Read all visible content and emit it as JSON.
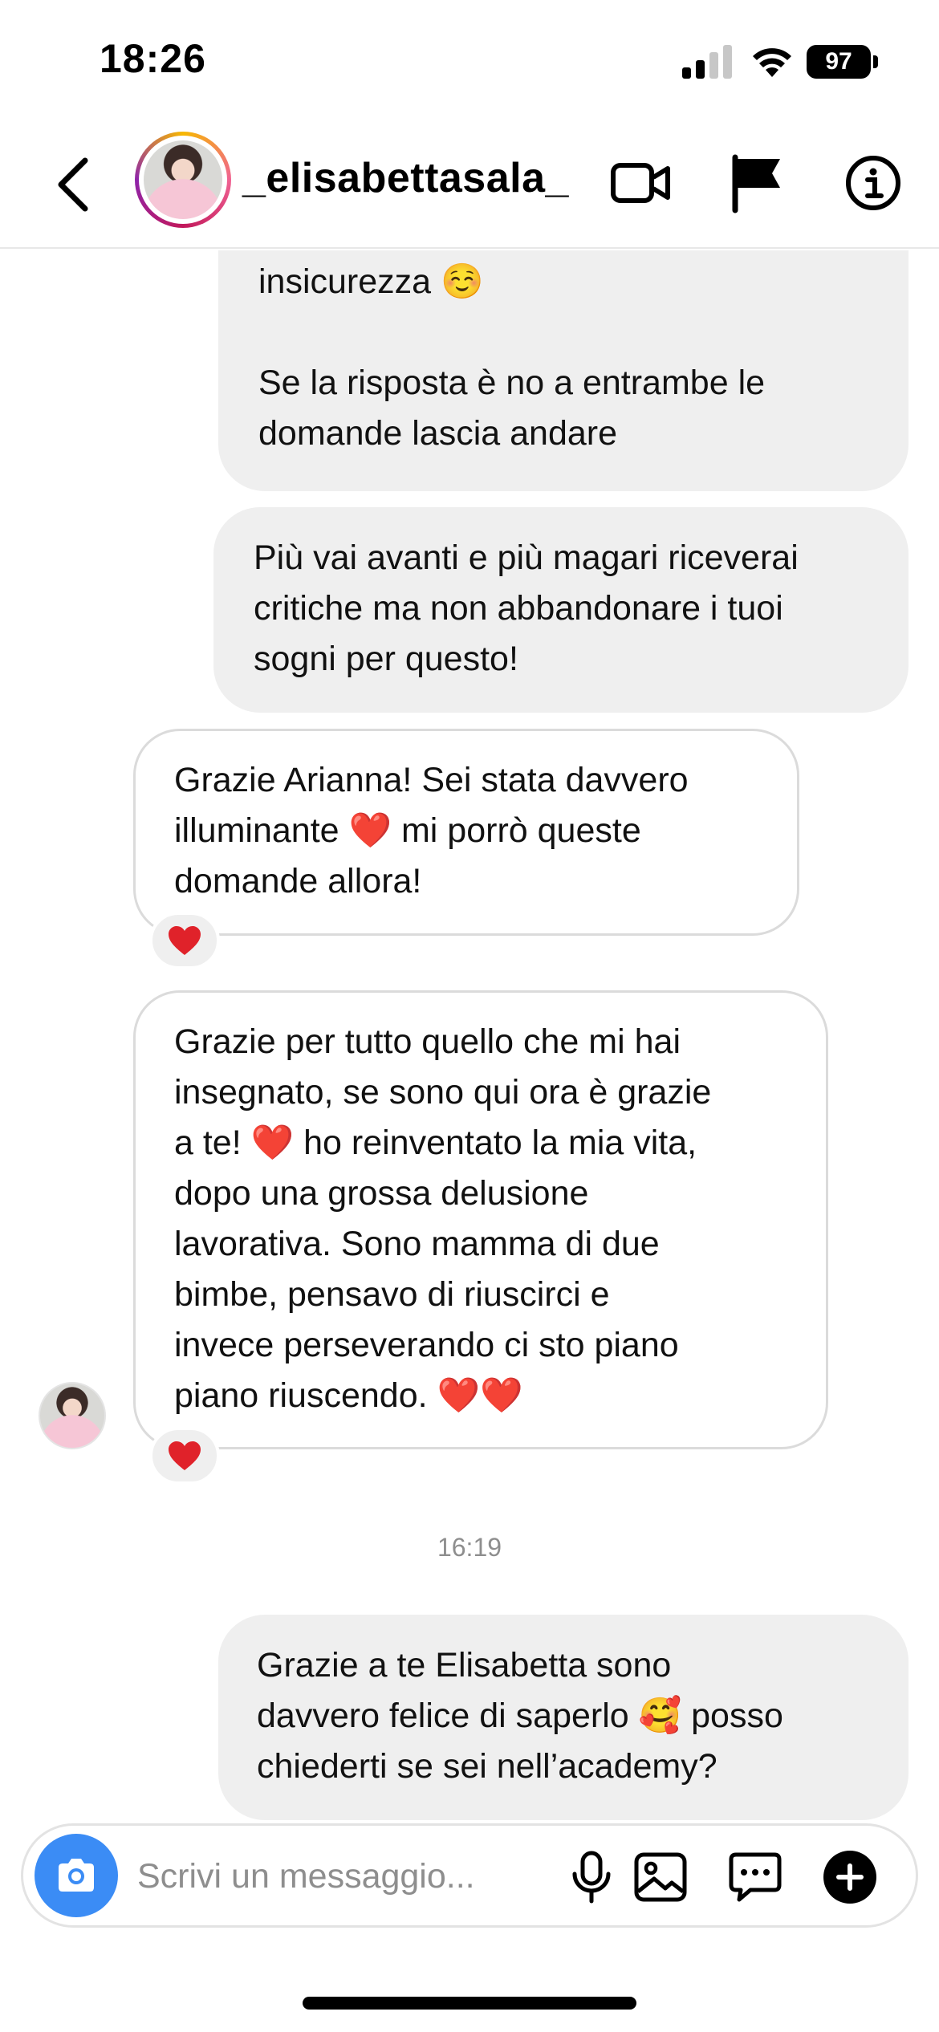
{
  "status_bar": {
    "time": "18:26",
    "battery": "97"
  },
  "header": {
    "username": "_elisabettasala_"
  },
  "messages": [
    {
      "from": "me",
      "lines": [
        "insicurezza ☺️",
        "",
        "Se la risposta è no a entrambe le",
        "domande lascia andare"
      ]
    },
    {
      "from": "me",
      "lines": [
        "Più vai avanti e più magari riceverai",
        "critiche ma non abbandonare i tuoi",
        "sogni per questo!"
      ]
    },
    {
      "from": "them",
      "lines": [
        "Grazie Arianna! Sei stata davvero",
        "illuminante ❤️ mi porrò queste",
        "domande allora!"
      ],
      "reaction": "❤️"
    },
    {
      "from": "them",
      "lines": [
        "Grazie per tutto quello che mi hai",
        "insegnato, se sono qui ora è grazie",
        "a te! ❤️ ho reinventato la mia vita,",
        "dopo una grossa delusione",
        "lavorativa. Sono mamma di due",
        "bimbe, pensavo di riuscirci e",
        "invece perseverando ci sto piano",
        "piano riuscendo. ❤️❤️"
      ],
      "reaction": "❤️"
    },
    {
      "from": "me",
      "lines": [
        "Grazie a te Elisabetta sono",
        "davvero felice di saperlo 🥰 posso",
        "chiederti se sei nell’academy?"
      ]
    }
  ],
  "timestamp": "16:19",
  "composer": {
    "placeholder": "Scrivi un messaggio...",
    "value": ""
  },
  "icons": {
    "status": [
      "signal-icon",
      "wifi-icon",
      "battery-icon"
    ],
    "header": [
      "chevron-left-icon",
      "video-call-icon",
      "flag-icon",
      "info-icon"
    ],
    "composer": [
      "camera-icon",
      "microphone-icon",
      "gallery-icon",
      "sticker-icon",
      "plus-icon"
    ]
  },
  "colors": {
    "accent": "#3b8cf5",
    "bubble_me": "#efefef",
    "bubble_them_border": "#dbdbdb",
    "heart": "#e0222a"
  }
}
